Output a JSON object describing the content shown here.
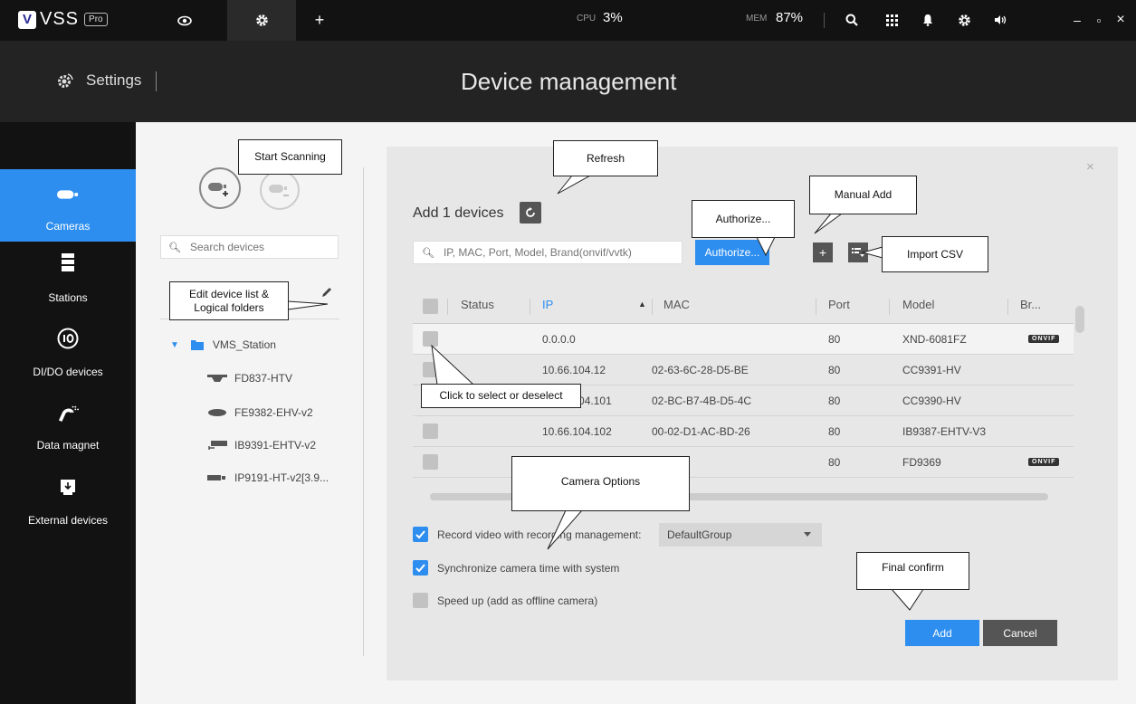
{
  "topbar": {
    "logo_letter": "V",
    "logo_text": "VSS",
    "logo_badge": "Pro",
    "cpu_label": "CPU",
    "cpu_value": "3%",
    "mem_label": "MEM",
    "mem_value": "87%",
    "window_min": "–",
    "window_max": "▫",
    "window_close": "×",
    "icons": [
      "eye-icon",
      "gear-icon",
      "plus-icon",
      "search-icon",
      "grid-icon",
      "bell-icon",
      "gear-icon",
      "speaker-icon"
    ]
  },
  "header": {
    "settings_label": "Settings",
    "page_title": "Device management"
  },
  "nav": {
    "items": [
      {
        "label": "Cameras",
        "icon": "camera-icon",
        "active": true
      },
      {
        "label": "Stations",
        "icon": "server-icon",
        "active": false
      },
      {
        "label": "DI/DO devices",
        "icon": "io-icon",
        "active": false
      },
      {
        "label": "Data magnet",
        "icon": "magnet-icon",
        "active": false
      },
      {
        "label": "External devices",
        "icon": "usb-icon",
        "active": false
      }
    ]
  },
  "devices_panel": {
    "search_placeholder": "Search devices",
    "tree": {
      "root": "VMS_Station",
      "children": [
        "FD837-HTV",
        "FE9382-EHV-v2",
        "IB9391-EHTV-v2",
        "IP9191-HT-v2[3.9..."
      ]
    }
  },
  "dialog": {
    "title": "Add 1 devices",
    "search_placeholder": "IP, MAC, Port, Model, Brand(onvif/vvtk)",
    "authorize_label": "Authorize...",
    "close": "×",
    "manual_add": "+",
    "table": {
      "headers": {
        "status": "Status",
        "ip": "IP",
        "mac": "MAC",
        "port": "Port",
        "model": "Model",
        "brand": "Br..."
      },
      "rows": [
        {
          "ip": "0.0.0.0",
          "mac": "",
          "port": "80",
          "model": "XND-6081FZ",
          "brand": "ONVIF",
          "checked": false
        },
        {
          "ip": "10.66.104.12",
          "mac": "02-63-6C-28-D5-BE",
          "port": "80",
          "model": "CC9391-HV",
          "brand": "",
          "checked": false
        },
        {
          "ip": "10.66.104.101",
          "mac": "02-BC-B7-4B-D5-4C",
          "port": "80",
          "model": "CC9390-HV",
          "brand": "",
          "checked": true
        },
        {
          "ip": "10.66.104.102",
          "mac": "00-02-D1-AC-BD-26",
          "port": "80",
          "model": "IB9387-EHTV-V3",
          "brand": "",
          "checked": false
        },
        {
          "ip": "",
          "mac": "",
          "port": "80",
          "model": "FD9369",
          "brand": "ONVIF",
          "checked": false
        }
      ]
    },
    "options": {
      "record_label": "Record video with recording management:",
      "record_checked": true,
      "record_group": "DefaultGroup",
      "sync_label": "Synchronize camera time with system",
      "sync_checked": true,
      "speed_label": "Speed up (add as offline camera)",
      "speed_checked": false
    },
    "add_label": "Add",
    "cancel_label": "Cancel"
  },
  "callouts": {
    "start_scanning": "Start Scanning",
    "refresh": "Refresh",
    "manual_add": "Manual Add",
    "authorize": "Authorize...",
    "import_csv": "Import CSV",
    "edit_device_list": "Edit device list & Logical folders",
    "click_select": "Click to select or deselect",
    "camera_options": "Camera Options",
    "final_confirm": "Final confirm"
  },
  "colors": {
    "accent": "#2d8ef0",
    "topbar": "#121212",
    "header": "#232323"
  }
}
